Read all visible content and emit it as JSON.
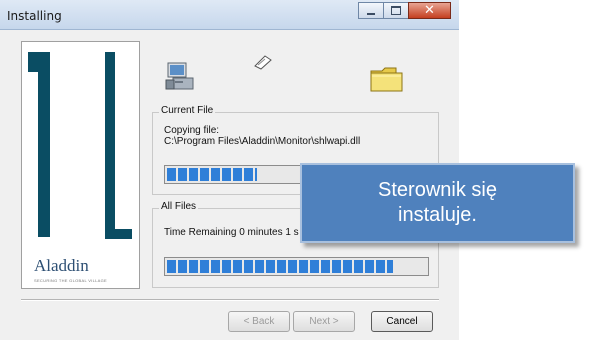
{
  "window": {
    "title": "Installing",
    "controls": {
      "minimize": "minimize-icon",
      "maximize": "maximize-icon",
      "close": "close-icon"
    }
  },
  "side_panel": {
    "logo": "Aladdin",
    "tagline": "SECURING THE GLOBAL VILLAGE"
  },
  "icons": [
    "computer-icon",
    "flying-paper-icon",
    "folder-icon"
  ],
  "current_file": {
    "label": "Current File",
    "copying_label": "Copying file:",
    "path": "C:\\Program Files\\Aladdin\\Monitor\\shlwapi.dll",
    "progress": 0.35
  },
  "all_files": {
    "label": "All Files",
    "time_remaining": "Time Remaining 0 minutes 1 s",
    "progress": 0.88
  },
  "buttons": {
    "back": "< Back",
    "next": "Next >",
    "cancel": "Cancel"
  },
  "callout": {
    "text": "Sterownik się instaluje."
  },
  "colors": {
    "progress": "#2f7fd8",
    "callout": "#4f81bd",
    "logo_bars": "#0a4d63"
  }
}
